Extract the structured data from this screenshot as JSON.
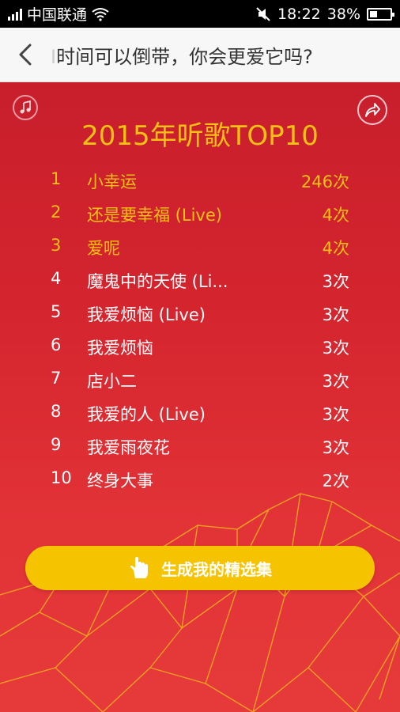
{
  "status_bar": {
    "carrier": "中国联通",
    "time": "18:22",
    "battery": "38%",
    "battery_level": 0.38,
    "icons": [
      "signal-icon",
      "wifi-icon",
      "mute-icon",
      "battery-icon"
    ]
  },
  "nav": {
    "title_cut": "I",
    "title": "时间可以倒带，你会更爱它吗?",
    "back_icon": "chevron-left-icon"
  },
  "page": {
    "title": "2015年听歌TOP10",
    "music_icon": "music-note-icon",
    "share_icon": "share-arrow-icon"
  },
  "top_songs": [
    {
      "rank": "1",
      "song": "小幸运",
      "count": "246次",
      "highlight": true
    },
    {
      "rank": "2",
      "song": "还是要幸福 (Live)",
      "count": "4次",
      "highlight": true
    },
    {
      "rank": "3",
      "song": "爱呢",
      "count": "4次",
      "highlight": true
    },
    {
      "rank": "4",
      "song": "魔鬼中的天使 (Li...",
      "count": "3次",
      "highlight": false
    },
    {
      "rank": "5",
      "song": "我爱烦恼 (Live)",
      "count": "3次",
      "highlight": false
    },
    {
      "rank": "6",
      "song": "我爱烦恼",
      "count": "3次",
      "highlight": false
    },
    {
      "rank": "7",
      "song": "店小二",
      "count": "3次",
      "highlight": false
    },
    {
      "rank": "8",
      "song": "我爱的人 (Live)",
      "count": "3次",
      "highlight": false
    },
    {
      "rank": "9",
      "song": "我爱雨夜花",
      "count": "3次",
      "highlight": false
    },
    {
      "rank": "10",
      "song": "终身大事",
      "count": "2次",
      "highlight": false
    }
  ],
  "action_button": {
    "label": "生成我的精选集",
    "icon": "hand-pointer-icon"
  },
  "colors": {
    "accent": "#f5c014",
    "button": "#f6c300",
    "background": "#d6262f"
  }
}
